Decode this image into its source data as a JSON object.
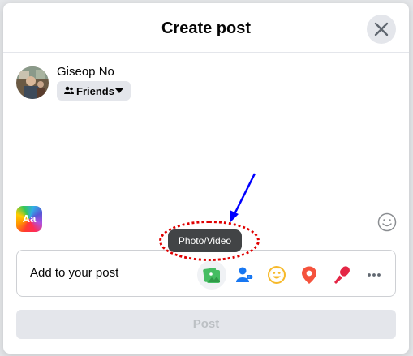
{
  "dialog": {
    "title": "Create post"
  },
  "user": {
    "name": "Giseop No",
    "audience": "Friends"
  },
  "composer": {
    "background_picker_label": "Aa"
  },
  "add_to_post": {
    "label": "Add to your post",
    "tools": [
      {
        "name": "photo-video",
        "icon": "photo-icon",
        "color": "#45bd62"
      },
      {
        "name": "tag-people",
        "icon": "tag-people-icon",
        "color": "#1877f2"
      },
      {
        "name": "feeling-activity",
        "icon": "smiley-icon",
        "color": "#f7b928"
      },
      {
        "name": "check-in",
        "icon": "location-pin-icon",
        "color": "#f5533d"
      },
      {
        "name": "live-video",
        "icon": "microphone-icon",
        "color": "#e42645"
      },
      {
        "name": "more",
        "icon": "more-dots-icon",
        "color": "#606770"
      }
    ]
  },
  "tooltip": {
    "text": "Photo/Video"
  },
  "post_button": {
    "label": "Post"
  },
  "colors": {
    "annotation_red": "#e00000",
    "annotation_blue": "#0000ff",
    "disabled_button": "#e4e6eb"
  }
}
